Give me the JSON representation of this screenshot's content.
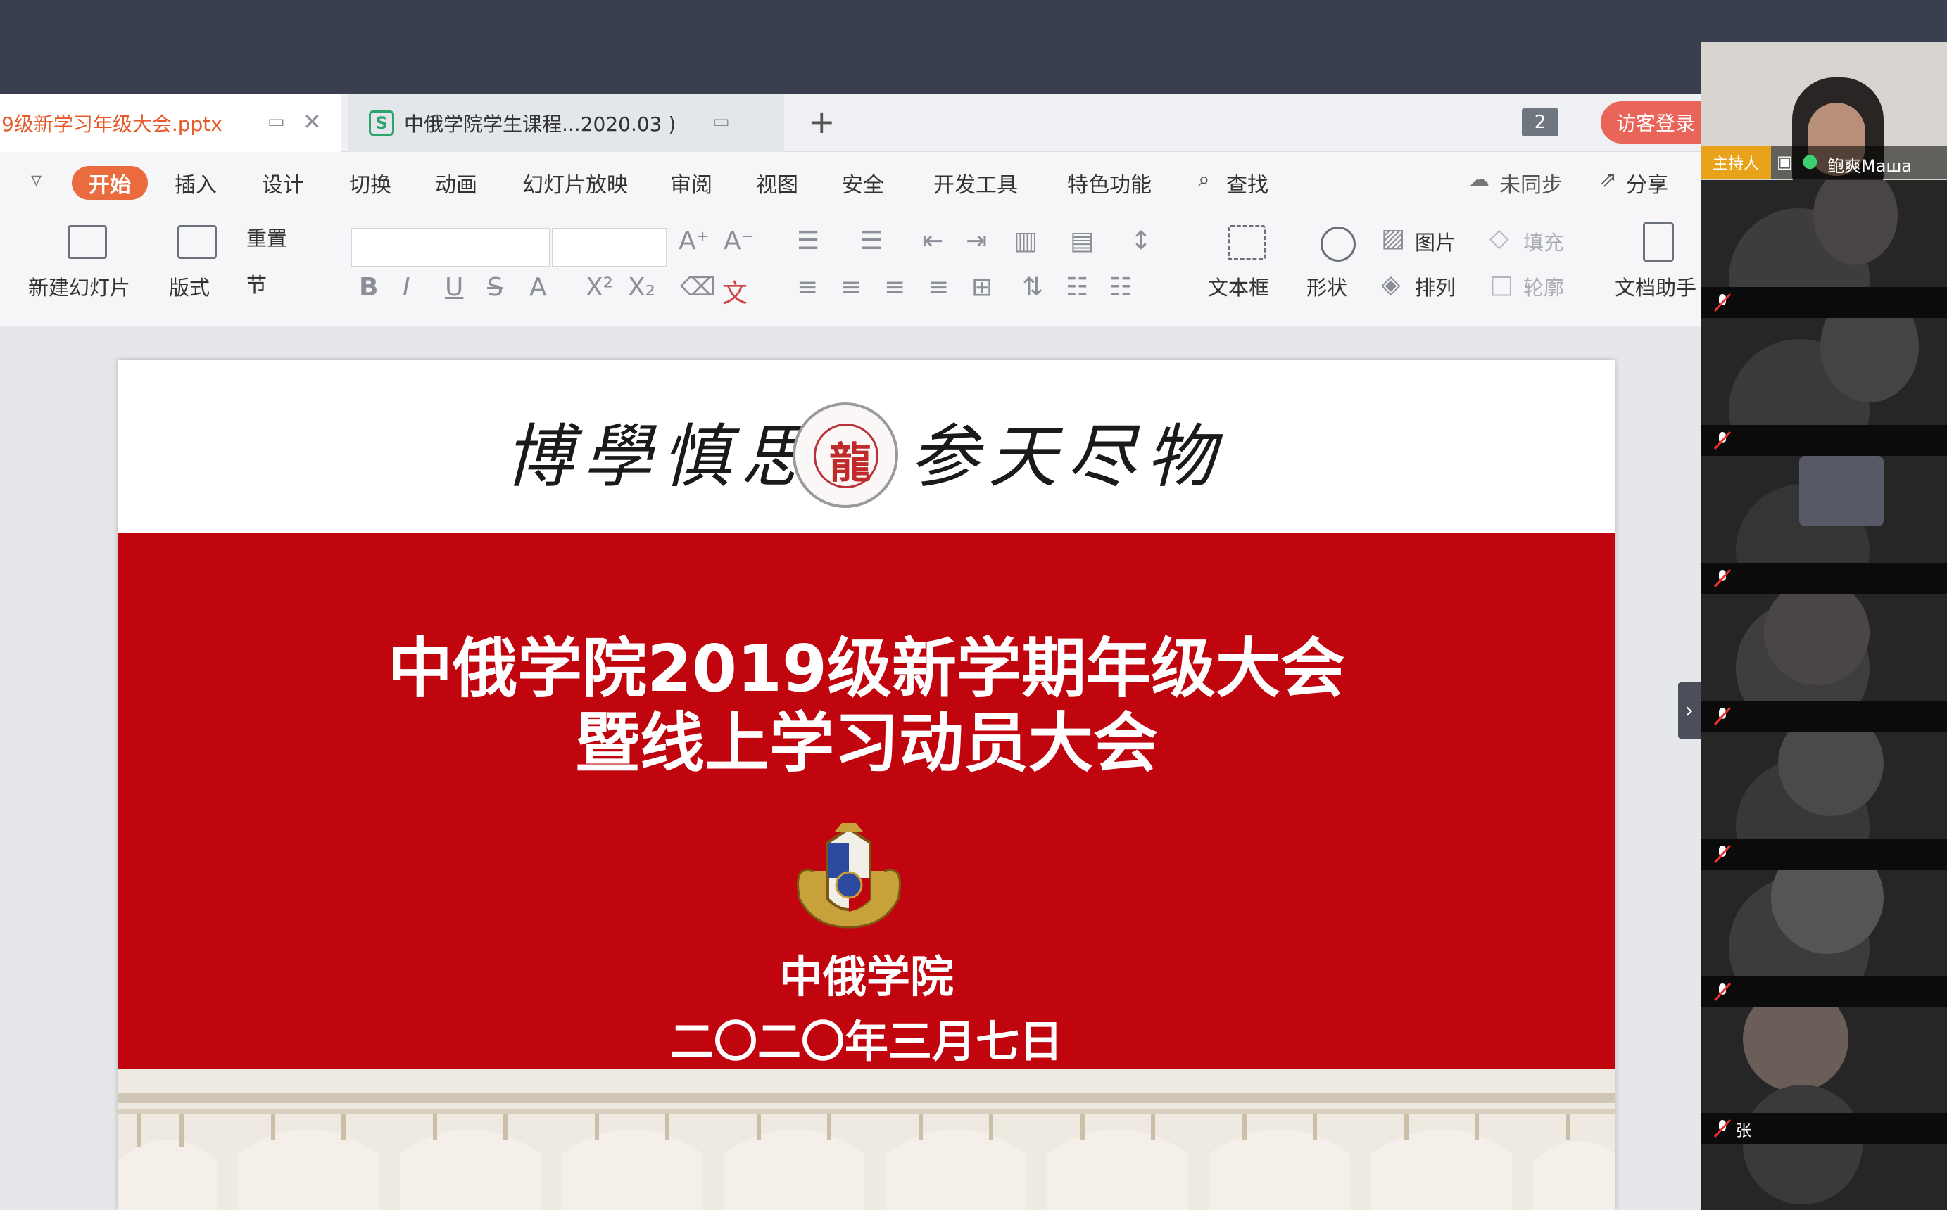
{
  "tabs": {
    "active_label": "9级新学习年级大会.pptx",
    "other_label": "中俄学院学生课程...2020.03 )",
    "other_badge": "S",
    "page_count": "2",
    "guest_login": "访客登录"
  },
  "menu": {
    "active": "开始",
    "items": [
      "插入",
      "设计",
      "切换",
      "动画",
      "幻灯片放映",
      "审阅",
      "视图",
      "安全",
      "开发工具",
      "特色功能"
    ],
    "search": "查找",
    "sync": "未同步",
    "share": "分享"
  },
  "ribbon": {
    "new_slide": "新建幻灯片",
    "layout": "版式",
    "reset": "重置",
    "section": "节",
    "textbox": "文本框",
    "shape": "形状",
    "picture": "图片",
    "arrange": "排列",
    "fill": "填充",
    "outline": "轮廓",
    "doc_assistant": "文档助手"
  },
  "slide": {
    "motto_left": "博學慎思",
    "motto_right": "参天尽物",
    "title_line1": "中俄学院2019级新学期年级大会",
    "title_line2": "暨线上学习动员大会",
    "org": "中俄学院",
    "date": "二〇二〇年三月七日"
  },
  "meeting": {
    "host_badge": "主持人",
    "host_name": "鲍爽Маша",
    "participants": [
      "",
      "",
      "",
      "",
      "",
      "",
      "张"
    ]
  },
  "colors": {
    "accent_orange": "#ea6b3d",
    "slide_red": "#c0050f",
    "host_badge": "#e8a31b"
  }
}
